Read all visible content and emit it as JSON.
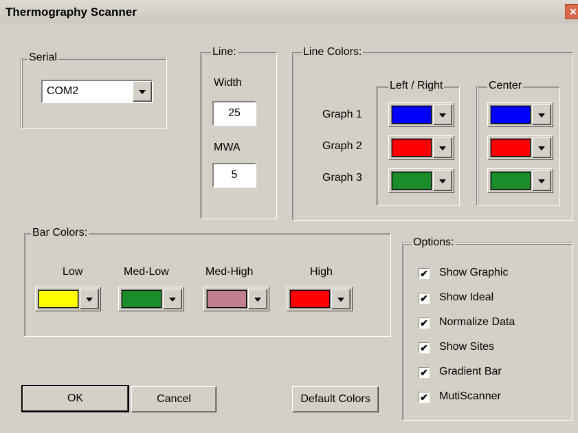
{
  "window": {
    "title": "Thermography Scanner",
    "close_glyph": "✕"
  },
  "serial": {
    "legend": "Serial",
    "port_value": "COM2"
  },
  "line": {
    "legend": "Line:",
    "width_label": "Width",
    "width_value": "25",
    "mwa_label": "MWA",
    "mwa_value": "5"
  },
  "line_colors": {
    "legend": "Line Colors:",
    "left_right_legend": "Left / Right",
    "center_legend": "Center",
    "graphs": [
      {
        "label": "Graph 1",
        "left_right_color": "#0000ff",
        "center_color": "#0000ff"
      },
      {
        "label": "Graph 2",
        "left_right_color": "#ff0000",
        "center_color": "#ff0000"
      },
      {
        "label": "Graph 3",
        "left_right_color": "#1a8c2a",
        "center_color": "#1a8c2a"
      }
    ]
  },
  "bar_colors": {
    "legend": "Bar Colors:",
    "items": [
      {
        "label": "Low",
        "color": "#ffff00"
      },
      {
        "label": "Med-Low",
        "color": "#1a8c2a"
      },
      {
        "label": "Med-High",
        "color": "#c0808f"
      },
      {
        "label": "High",
        "color": "#ff0000"
      }
    ]
  },
  "options": {
    "legend": "Options:",
    "check_glyph": "✔",
    "items": [
      {
        "label": "Show Graphic",
        "checked": true
      },
      {
        "label": "Show Ideal",
        "checked": true
      },
      {
        "label": "Normalize Data",
        "checked": true
      },
      {
        "label": "Show Sites",
        "checked": true
      },
      {
        "label": "Gradient Bar",
        "checked": true
      },
      {
        "label": "MutiScanner",
        "checked": true
      }
    ]
  },
  "buttons": {
    "ok": "OK",
    "cancel": "Cancel",
    "default_colors": "Default Colors"
  }
}
